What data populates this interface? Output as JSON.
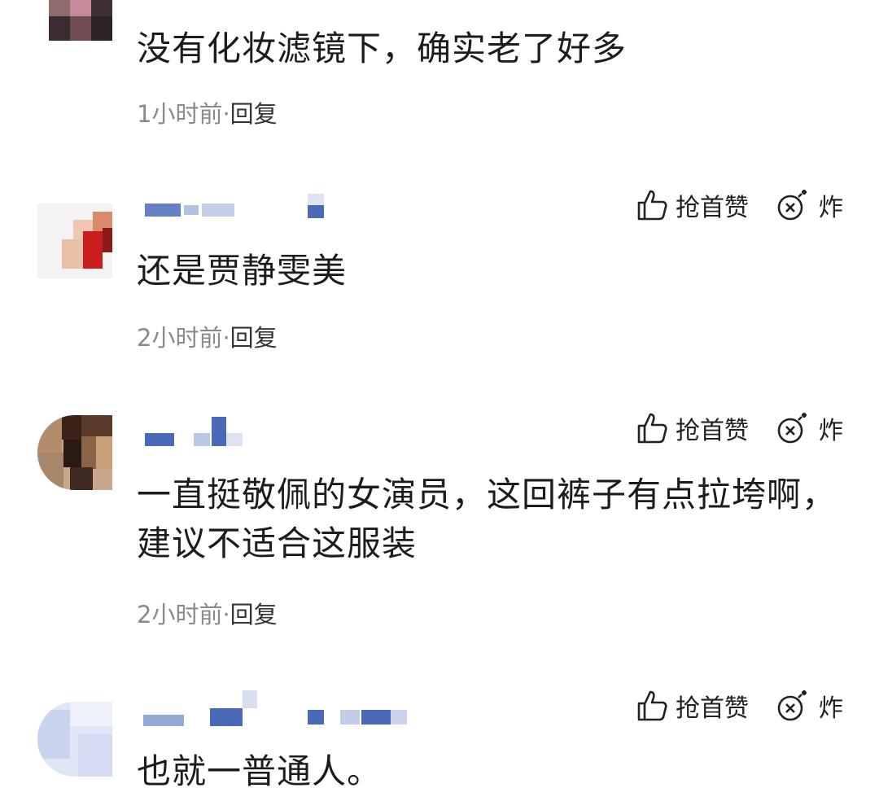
{
  "comments": [
    {
      "text": "没有化妆滤镜下，确实老了好多",
      "time": "1小时前",
      "separator": "·",
      "reply_label": "回复",
      "show_actions": false
    },
    {
      "text": "还是贾静雯美",
      "time": "2小时前",
      "separator": "·",
      "reply_label": "回复",
      "show_actions": true
    },
    {
      "text": "一直挺敬佩的女演员，这回裤子有点拉垮啊，建议不适合这服装",
      "time": "2小时前",
      "separator": "·",
      "reply_label": "回复",
      "show_actions": true
    },
    {
      "text": "也就一普通人。",
      "time": "",
      "separator": "",
      "reply_label": "",
      "show_actions": true
    }
  ],
  "actions": {
    "like_label": "抢首赞",
    "bomb_label": "炸",
    "like_icon": "thumbs-up-icon",
    "bomb_icon": "bomb-icon"
  },
  "colors": {
    "username_blur": "#4a6ab8",
    "meta_text": "#8a8a8a",
    "body_text": "#1c1c1c"
  }
}
